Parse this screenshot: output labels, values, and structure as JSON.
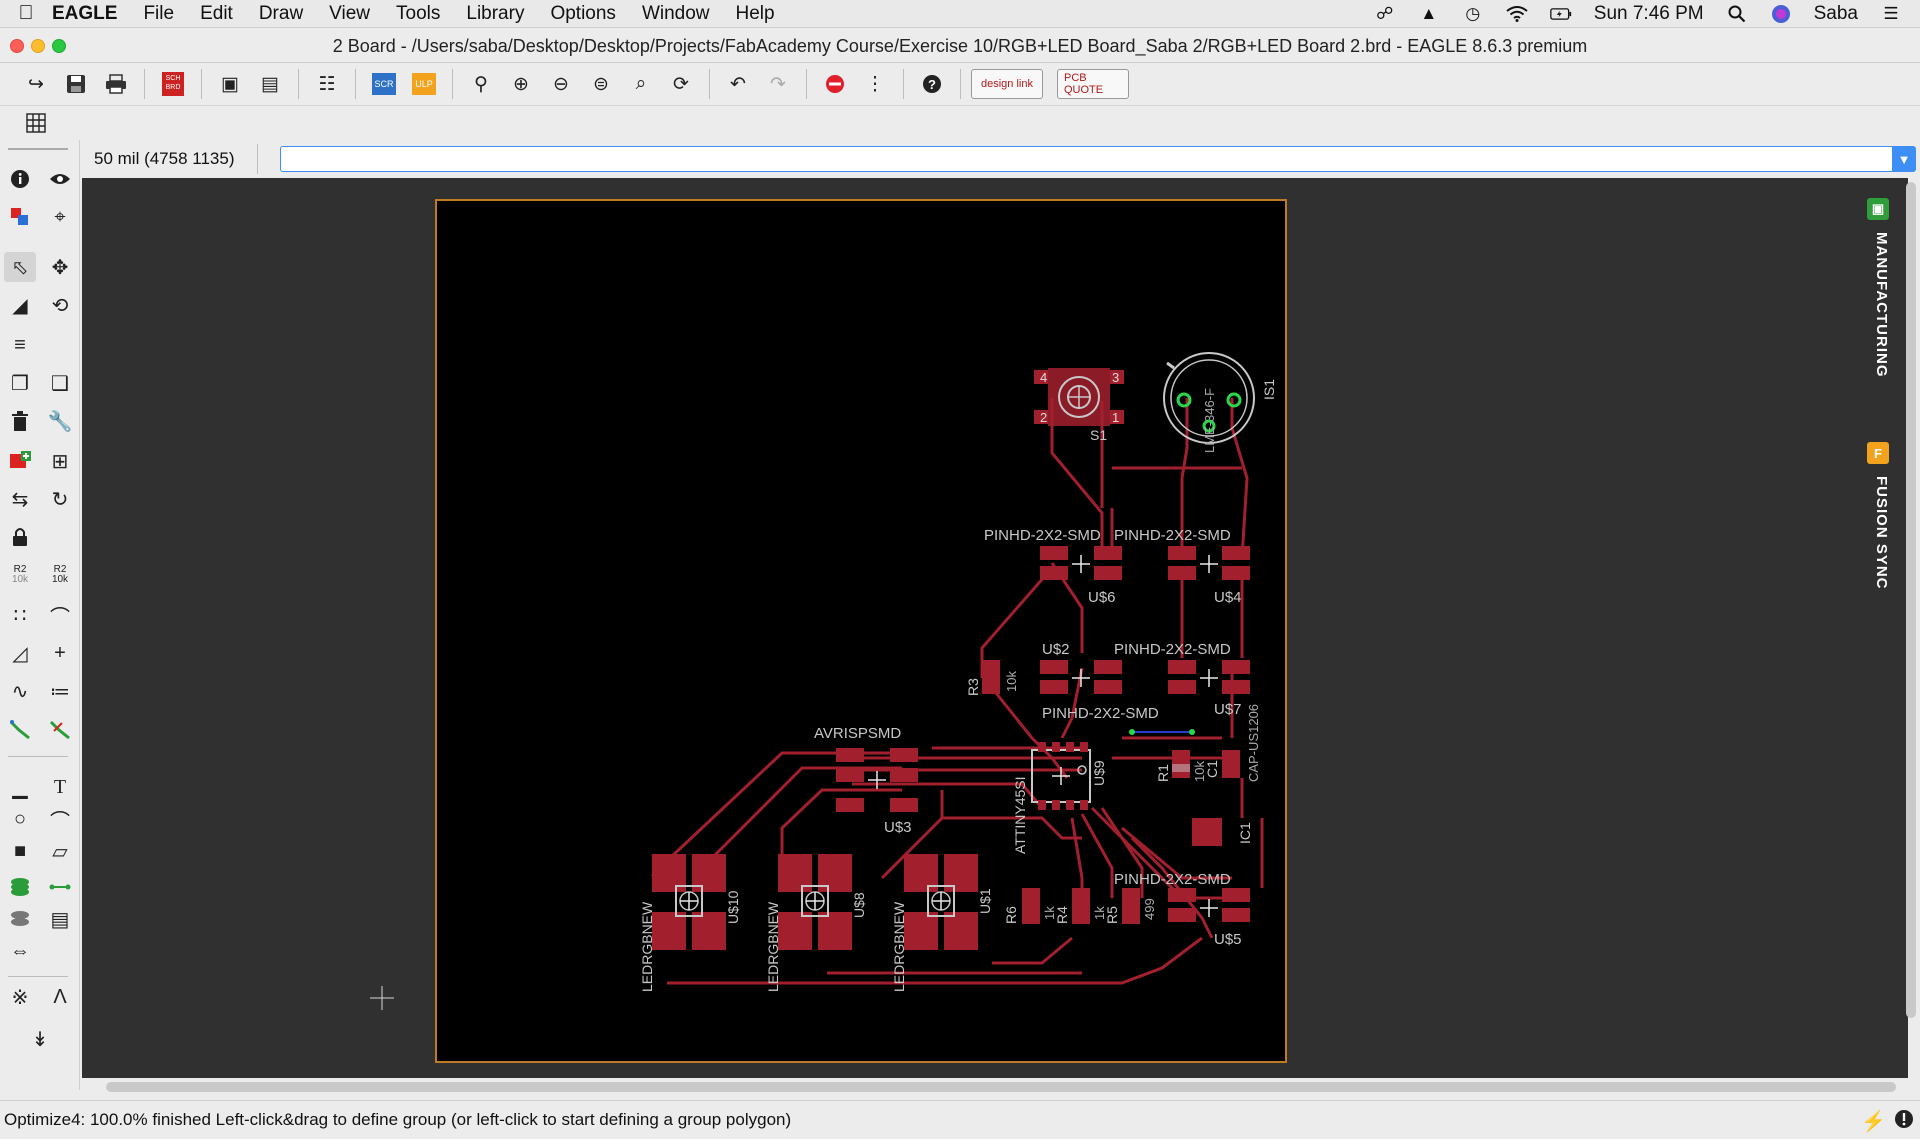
{
  "menubar": {
    "app_name": "EAGLE",
    "menus": [
      "File",
      "Edit",
      "Draw",
      "View",
      "Tools",
      "Library",
      "Options",
      "Window",
      "Help"
    ],
    "clock": "Sun 7:46 PM",
    "user": "Saba"
  },
  "window": {
    "title": "2 Board - /Users/saba/Desktop/Desktop/Projects/FabAcademy Course/Exercise 10/RGB+LED Board_Saba 2/RGB+LED Board 2.brd - EAGLE 8.6.3 premium"
  },
  "toolbar": {
    "sch_brd_label": "SCH BRD",
    "scr_label": "SCR",
    "ulp_label": "ULP",
    "design_link_label": "design link",
    "pcb_quote_label": "PCB QUOTE"
  },
  "commandline": {
    "coordinate": "50 mil (4758 1135)",
    "value": ""
  },
  "palette": {
    "r2_label": "R2",
    "r2_value": "10k"
  },
  "side_panels": {
    "manufacturing": "MANUFACTURING",
    "fusion_sync": "FUSION SYNC"
  },
  "board_labels": {
    "pinhd_1": "PINHD-2X2-SMD",
    "pinhd_2": "PINHD-2X2-SMD",
    "pinhd_3": "PINHD-2X2-SMD",
    "pinhd_4": "PINHD-2X2-SMD",
    "pinhd_5": "PINHD-2X2-SMD",
    "s1": "S1",
    "is1": "IS1",
    "us6": "U$6",
    "us4": "U$4",
    "us2": "U$2",
    "us7": "U$7",
    "us3": "U$3",
    "us5": "U$5",
    "us9": "U$9",
    "us10": "U$10",
    "us8": "U$8",
    "us1": "U$1",
    "r3": "R3",
    "r3_val": "10k",
    "r1": "R1",
    "r1_val": "10k",
    "c1": "C1",
    "cap": "CAP-US1206",
    "ic1": "IC1",
    "avrisp": "AVRISPSMD",
    "attiny": "ATTINY45SI",
    "r6": "R6",
    "r6_val": "1k",
    "r4": "R4",
    "r4_val": "1k",
    "r5": "R5",
    "r5_val": "499",
    "led1": "LEDRGBNEW",
    "led2": "LEDRGBNEW",
    "led3": "LEDRGBNEW",
    "lme": "LME-346-F",
    "pin1": "1",
    "pin2": "2",
    "pin3": "3",
    "pin4": "4"
  },
  "status": {
    "text": "Optimize4: 100.0% finished Left-click&drag to define group (or left-click to start defining a group polygon)"
  },
  "colors": {
    "board_bg": "#000000",
    "canvas_bg": "#303030",
    "board_outline": "#c07a20",
    "copper": "#a2202e",
    "silk": "#c8c8c8",
    "accent_blue": "#3d8ef5"
  }
}
